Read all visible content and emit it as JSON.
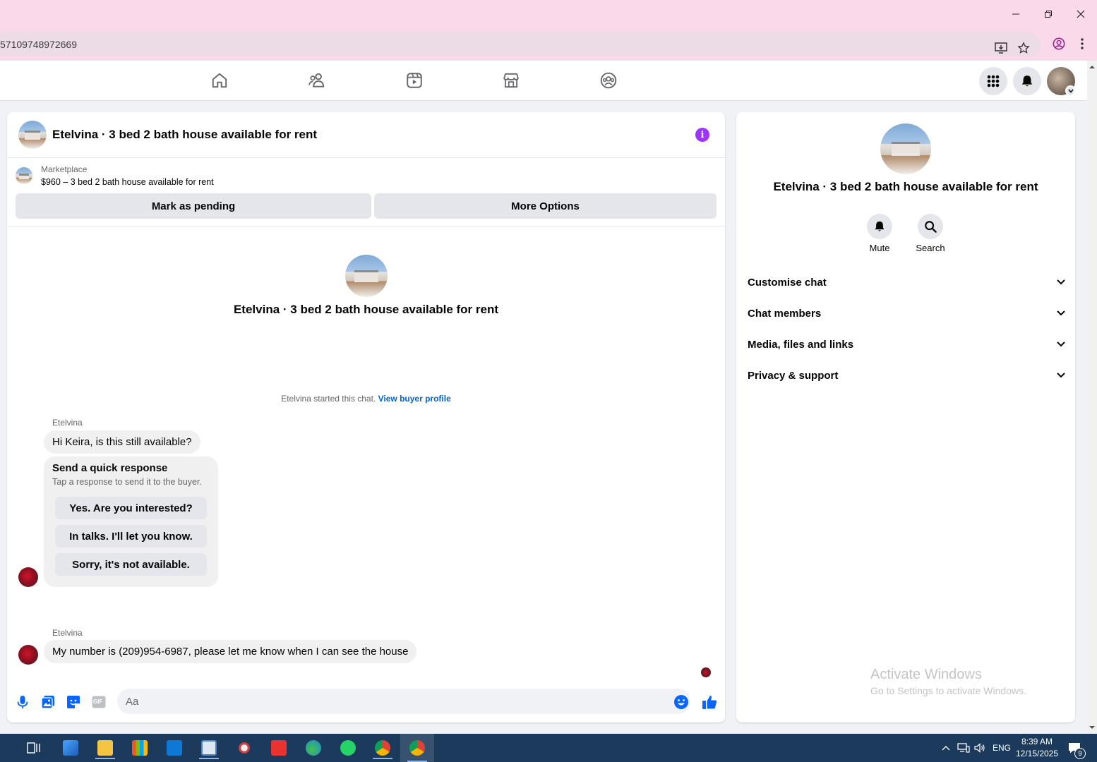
{
  "browser": {
    "url_fragment": "57109748972669"
  },
  "chat": {
    "header_title": "Etelvina · 3 bed 2 bath house available for rent",
    "marketplace_label": "Marketplace",
    "listing_price_line": "$960 – 3 bed 2 bath house available for rent",
    "mark_pending_label": "Mark as pending",
    "more_options_label": "More Options",
    "center_title": "Etelvina · 3 bed 2 bath house available for rent",
    "started_text": "Etelvina started this chat.",
    "view_profile_link": "View buyer profile",
    "messages": [
      {
        "sender": "Etelvina",
        "text": "Hi Keira, is this still available?"
      },
      {
        "sender": "Etelvina",
        "text": "My number is (209)954-6987, please let me know when I can see the house"
      }
    ],
    "quick_response": {
      "title": "Send a quick response",
      "subtitle": "Tap a response to send it to the buyer.",
      "options": [
        "Yes. Are you interested?",
        "In talks. I'll let you know.",
        "Sorry, it's not available."
      ]
    },
    "composer": {
      "placeholder": "Aa",
      "gif_label": "GIF"
    }
  },
  "sidebar": {
    "title": "Etelvina · 3 bed 2 bath house available for rent",
    "actions": [
      {
        "label": "Mute",
        "icon": "bell-icon"
      },
      {
        "label": "Search",
        "icon": "search-icon"
      }
    ],
    "sections": [
      "Customise chat",
      "Chat members",
      "Media, files and links",
      "Privacy & support"
    ]
  },
  "watermark": {
    "line1": "Activate Windows",
    "line2": "Go to Settings to activate Windows."
  },
  "taskbar": {
    "language": "ENG",
    "time": "8:39 AM",
    "date": "12/15/2025",
    "notification_count": "9"
  },
  "colors": {
    "fb_blue": "#0866ff",
    "info_purple": "#a033ff",
    "titlebar_pink": "#f9d9ea",
    "taskbar": "#1c3a5c"
  }
}
